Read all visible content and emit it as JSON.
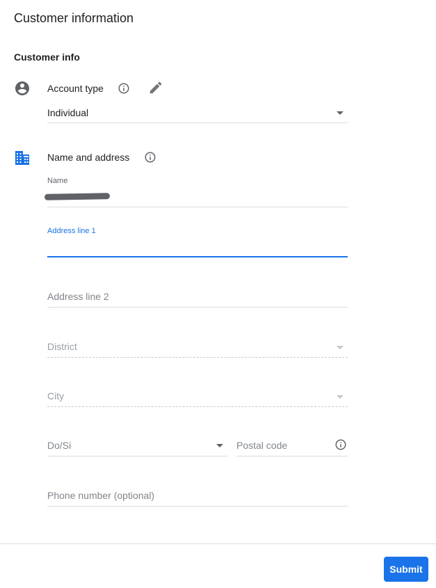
{
  "page": {
    "title": "Customer information"
  },
  "section": {
    "title": "Customer info"
  },
  "account_type": {
    "label": "Account type",
    "icon": "account-circle-icon",
    "info_icon": "info-icon",
    "edit_icon": "pencil-icon",
    "value": "Individual"
  },
  "name_address": {
    "label": "Name and address",
    "icon": "business-building-icon",
    "info_icon": "info-icon"
  },
  "fields": {
    "name_label": "Name",
    "address_line1_label": "Address line 1",
    "address_line2_placeholder": "Address line 2",
    "district_placeholder": "District",
    "city_placeholder": "City",
    "dosi_placeholder": "Do/Si",
    "postal_code_placeholder": "Postal code",
    "postal_info_icon": "info-icon",
    "phone_placeholder": "Phone number (optional)"
  },
  "actions": {
    "submit_label": "Submit"
  },
  "colors": {
    "accent": "#1a73e8",
    "icon_grey": "#5f6368",
    "divider": "#dadce0"
  }
}
